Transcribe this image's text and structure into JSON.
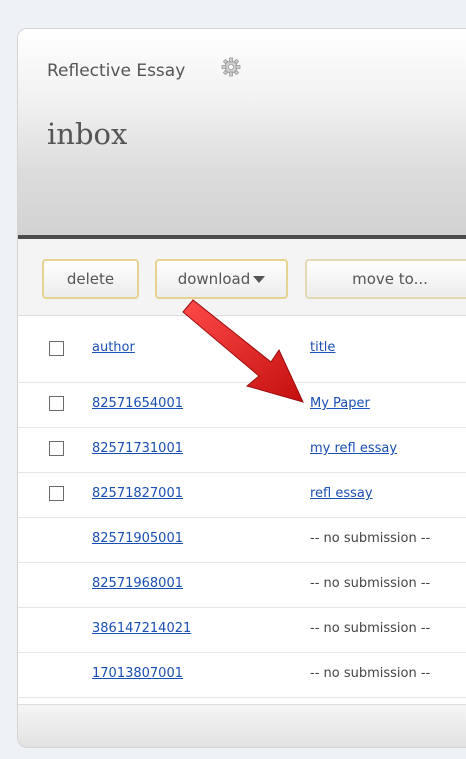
{
  "header": {
    "assignment_title": "Reflective Essay",
    "page_title": "inbox",
    "icon": "gear-icon"
  },
  "toolbar": {
    "delete_label": "delete",
    "download_label": "download",
    "move_label": "move to..."
  },
  "table": {
    "columns": {
      "author": "author",
      "title": "title"
    },
    "rows": [
      {
        "author": "82571654001",
        "title": "My Paper",
        "has_checkbox": true,
        "submitted": true
      },
      {
        "author": "82571731001",
        "title": "my refl essay",
        "has_checkbox": true,
        "submitted": true
      },
      {
        "author": "82571827001",
        "title": "refl essay",
        "has_checkbox": true,
        "submitted": true
      },
      {
        "author": "82571905001",
        "title": "-- no submission --",
        "has_checkbox": false,
        "submitted": false
      },
      {
        "author": "82571968001",
        "title": "-- no submission --",
        "has_checkbox": false,
        "submitted": false
      },
      {
        "author": "386147214021",
        "title": "-- no submission --",
        "has_checkbox": false,
        "submitted": false
      },
      {
        "author": "17013807001",
        "title": "-- no submission --",
        "has_checkbox": false,
        "submitted": false
      }
    ]
  },
  "colors": {
    "link": "#1a4fb3",
    "button_border": "#e7d28f",
    "header_rule": "#4b4b4b",
    "annotation_arrow": "#e01b1b"
  }
}
